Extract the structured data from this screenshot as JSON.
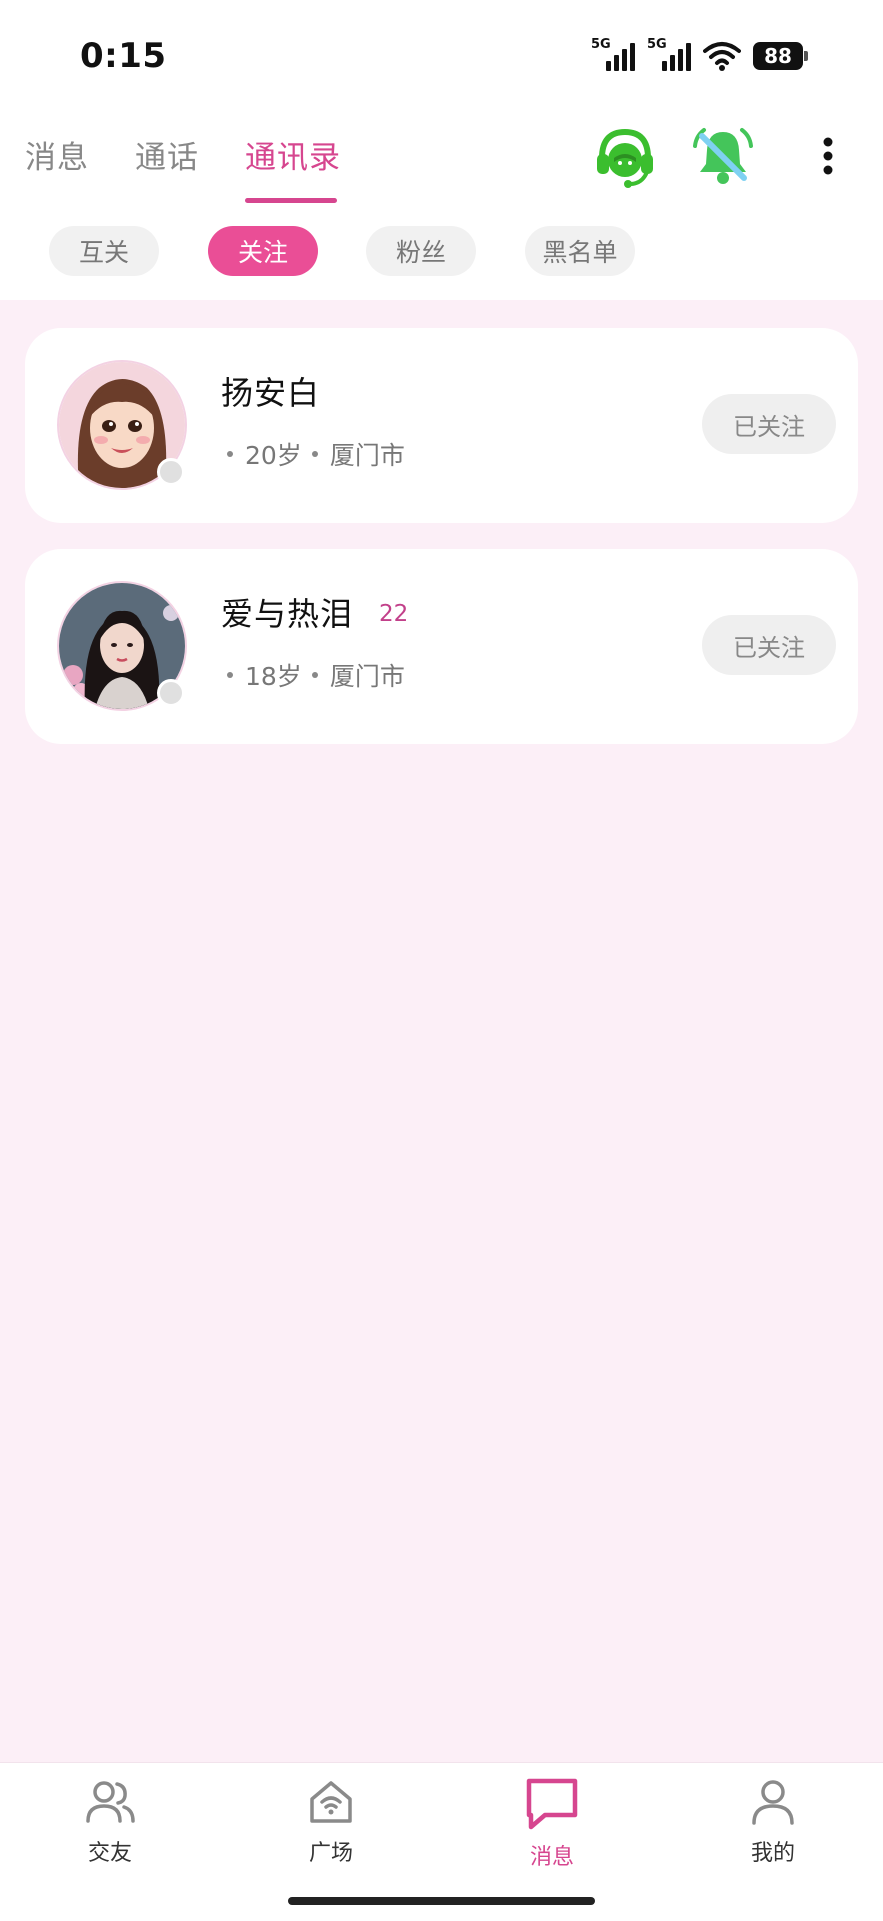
{
  "status_bar": {
    "time": "0:15",
    "network1": "5G",
    "network2": "5G",
    "battery": "88"
  },
  "header": {
    "tabs": [
      {
        "label": "消息",
        "active": false
      },
      {
        "label": "通话",
        "active": false
      },
      {
        "label": "通讯录",
        "active": true
      }
    ],
    "icons": [
      "customer-service-icon",
      "bell-muted-icon",
      "more-vertical-icon"
    ]
  },
  "filters": {
    "chips": [
      {
        "label": "互关",
        "active": false
      },
      {
        "label": "关注",
        "active": true
      },
      {
        "label": "粉丝",
        "active": false
      },
      {
        "label": "黑名单",
        "active": false
      }
    ]
  },
  "contacts": [
    {
      "name": "扬安白",
      "count": "",
      "age": "20岁",
      "city": "厦门市",
      "button_label": "已关注"
    },
    {
      "name": "爱与热泪",
      "count": "22",
      "age": "18岁",
      "city": "厦门市",
      "button_label": "已关注"
    }
  ],
  "bottom_nav": {
    "items": [
      {
        "label": "交友",
        "icon": "friends-icon",
        "active": false
      },
      {
        "label": "广场",
        "icon": "square-icon",
        "active": false
      },
      {
        "label": "消息",
        "icon": "message-icon",
        "active": true
      },
      {
        "label": "我的",
        "icon": "profile-icon",
        "active": false
      }
    ]
  },
  "colors": {
    "accent": "#D6468F",
    "chip_active": "#EA4E96",
    "page_background": "#FCEFF7",
    "icon_green": "#3BBE2E"
  }
}
